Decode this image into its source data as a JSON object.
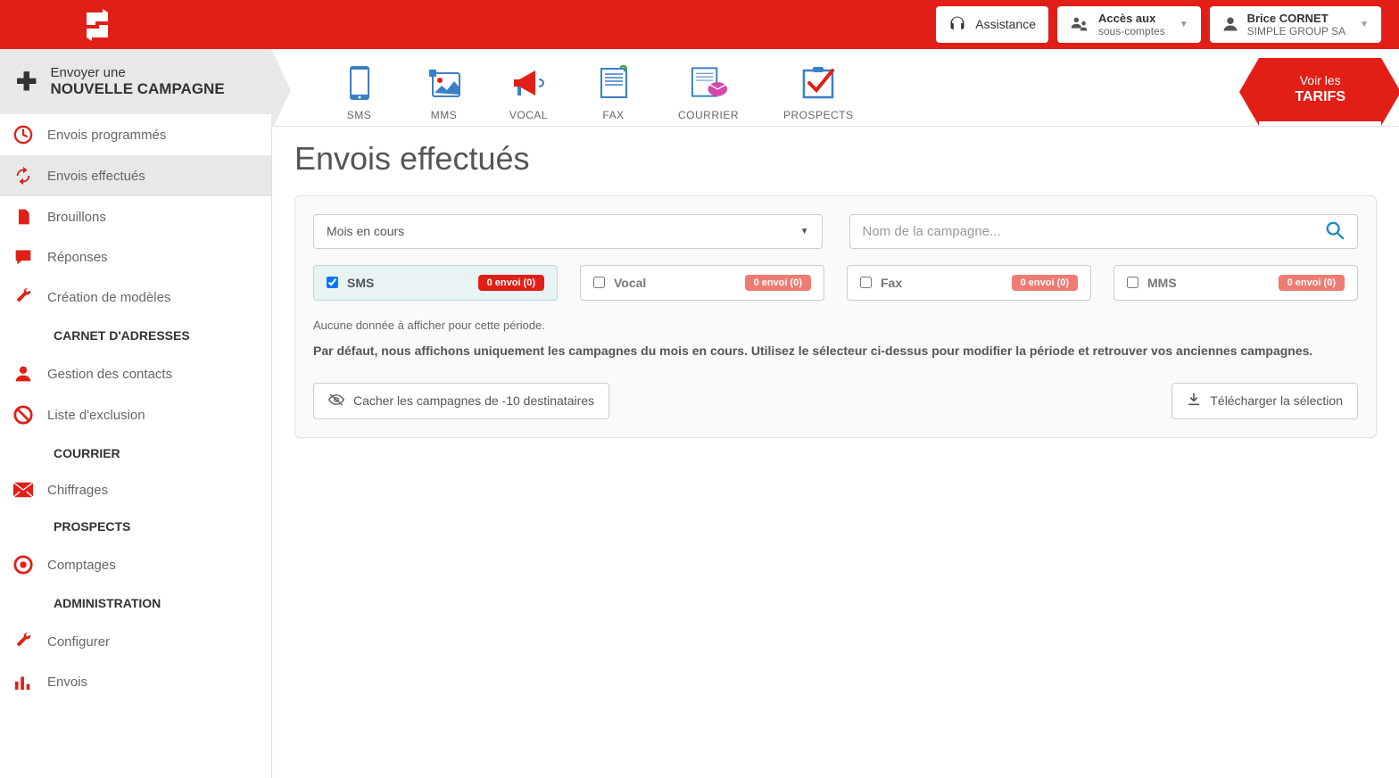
{
  "header": {
    "assistance": "Assistance",
    "accounts": {
      "label1": "Accès aux",
      "label2": "sous-comptes"
    },
    "user": {
      "name": "Brice CORNET",
      "company": "SIMPLE GROUP SA"
    }
  },
  "sidebar": {
    "newCampaign": {
      "line1": "Envoyer une",
      "line2": "NOUVELLE CAMPAGNE"
    },
    "items": {
      "scheduled": "Envois programmés",
      "completed": "Envois effectués",
      "drafts": "Brouillons",
      "replies": "Réponses",
      "templates": "Création de modèles",
      "contacts": "Gestion des contacts",
      "exclusion": "Liste d'exclusion",
      "quotes": "Chiffrages",
      "counts": "Comptages",
      "configure": "Configurer",
      "sends": "Envois"
    },
    "sections": {
      "addressBook": "CARNET D'ADRESSES",
      "mail": "COURRIER",
      "prospects": "PROSPECTS",
      "admin": "ADMINISTRATION"
    }
  },
  "channels": {
    "sms": "SMS",
    "mms": "MMS",
    "vocal": "VOCAL",
    "fax": "FAX",
    "mail": "COURRIER",
    "prospects": "PROSPECTS"
  },
  "tarifs": {
    "line1": "Voir les",
    "line2": "TARIFS"
  },
  "page": {
    "title": "Envois effectués",
    "period": "Mois en cours",
    "searchPlaceholder": "Nom de la campagne...",
    "filters": {
      "sms": {
        "label": "SMS",
        "badge": "0 envoi (0)",
        "checked": true
      },
      "vocal": {
        "label": "Vocal",
        "badge": "0 envoi (0)",
        "checked": false
      },
      "fax": {
        "label": "Fax",
        "badge": "0 envoi (0)",
        "checked": false
      },
      "mms": {
        "label": "MMS",
        "badge": "0 envoi (0)",
        "checked": false
      }
    },
    "noData": "Aucune donnée à afficher pour cette période.",
    "defaultInfo": "Par défaut, nous affichons uniquement les campagnes du mois en cours. Utilisez le sélecteur ci-dessus pour modifier la période et retrouver vos anciennes campagnes.",
    "hideBtn": "Cacher les campagnes de -10 destinataires",
    "downloadBtn": "Télécharger la sélection"
  }
}
